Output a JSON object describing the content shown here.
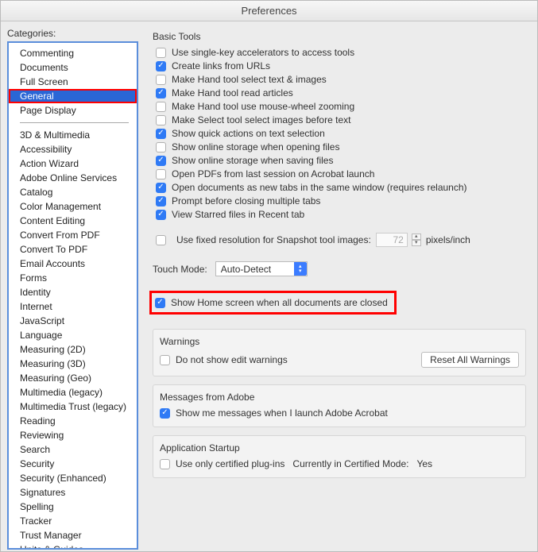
{
  "window": {
    "title": "Preferences"
  },
  "sidebar": {
    "label": "Categories:",
    "items_top": [
      {
        "label": "Commenting"
      },
      {
        "label": "Documents"
      },
      {
        "label": "Full Screen"
      },
      {
        "label": "General",
        "selected": true
      },
      {
        "label": "Page Display"
      }
    ],
    "items_bottom": [
      {
        "label": "3D & Multimedia"
      },
      {
        "label": "Accessibility"
      },
      {
        "label": "Action Wizard"
      },
      {
        "label": "Adobe Online Services"
      },
      {
        "label": "Catalog"
      },
      {
        "label": "Color Management"
      },
      {
        "label": "Content Editing"
      },
      {
        "label": "Convert From PDF"
      },
      {
        "label": "Convert To PDF"
      },
      {
        "label": "Email Accounts"
      },
      {
        "label": "Forms"
      },
      {
        "label": "Identity"
      },
      {
        "label": "Internet"
      },
      {
        "label": "JavaScript"
      },
      {
        "label": "Language"
      },
      {
        "label": "Measuring (2D)"
      },
      {
        "label": "Measuring (3D)"
      },
      {
        "label": "Measuring (Geo)"
      },
      {
        "label": "Multimedia (legacy)"
      },
      {
        "label": "Multimedia Trust (legacy)"
      },
      {
        "label": "Reading"
      },
      {
        "label": "Reviewing"
      },
      {
        "label": "Search"
      },
      {
        "label": "Security"
      },
      {
        "label": "Security (Enhanced)"
      },
      {
        "label": "Signatures"
      },
      {
        "label": "Spelling"
      },
      {
        "label": "Tracker"
      },
      {
        "label": "Trust Manager"
      },
      {
        "label": "Units & Guides"
      }
    ]
  },
  "basic_tools": {
    "title": "Basic Tools",
    "options": [
      {
        "label": "Use single-key accelerators to access tools",
        "checked": false
      },
      {
        "label": "Create links from URLs",
        "checked": true
      },
      {
        "label": "Make Hand tool select text & images",
        "checked": false
      },
      {
        "label": "Make Hand tool read articles",
        "checked": true
      },
      {
        "label": "Make Hand tool use mouse-wheel zooming",
        "checked": false
      },
      {
        "label": "Make Select tool select images before text",
        "checked": false
      },
      {
        "label": "Show quick actions on text selection",
        "checked": true
      },
      {
        "label": "Show online storage when opening files",
        "checked": false
      },
      {
        "label": "Show online storage when saving files",
        "checked": true
      },
      {
        "label": "Open PDFs from last session on Acrobat launch",
        "checked": false
      },
      {
        "label": "Open documents as new tabs in the same window (requires relaunch)",
        "checked": true
      },
      {
        "label": "Prompt before closing multiple tabs",
        "checked": true
      },
      {
        "label": "View Starred files in Recent tab",
        "checked": true
      }
    ],
    "snapshot": {
      "label": "Use fixed resolution for Snapshot tool images:",
      "checked": false,
      "value": "72",
      "unit": "pixels/inch"
    },
    "touch_mode": {
      "label": "Touch Mode:",
      "value": "Auto-Detect"
    },
    "home_screen": {
      "label": "Show Home screen when all documents are closed",
      "checked": true
    }
  },
  "warnings": {
    "title": "Warnings",
    "option": {
      "label": "Do not show edit warnings",
      "checked": false
    },
    "button": "Reset All Warnings"
  },
  "messages": {
    "title": "Messages from Adobe",
    "option": {
      "label": "Show me messages when I launch Adobe Acrobat",
      "checked": true
    }
  },
  "startup": {
    "title": "Application Startup",
    "option": {
      "label": "Use only certified plug-ins",
      "checked": false
    },
    "cert_label": "Currently in Certified Mode:",
    "cert_value": "Yes"
  }
}
